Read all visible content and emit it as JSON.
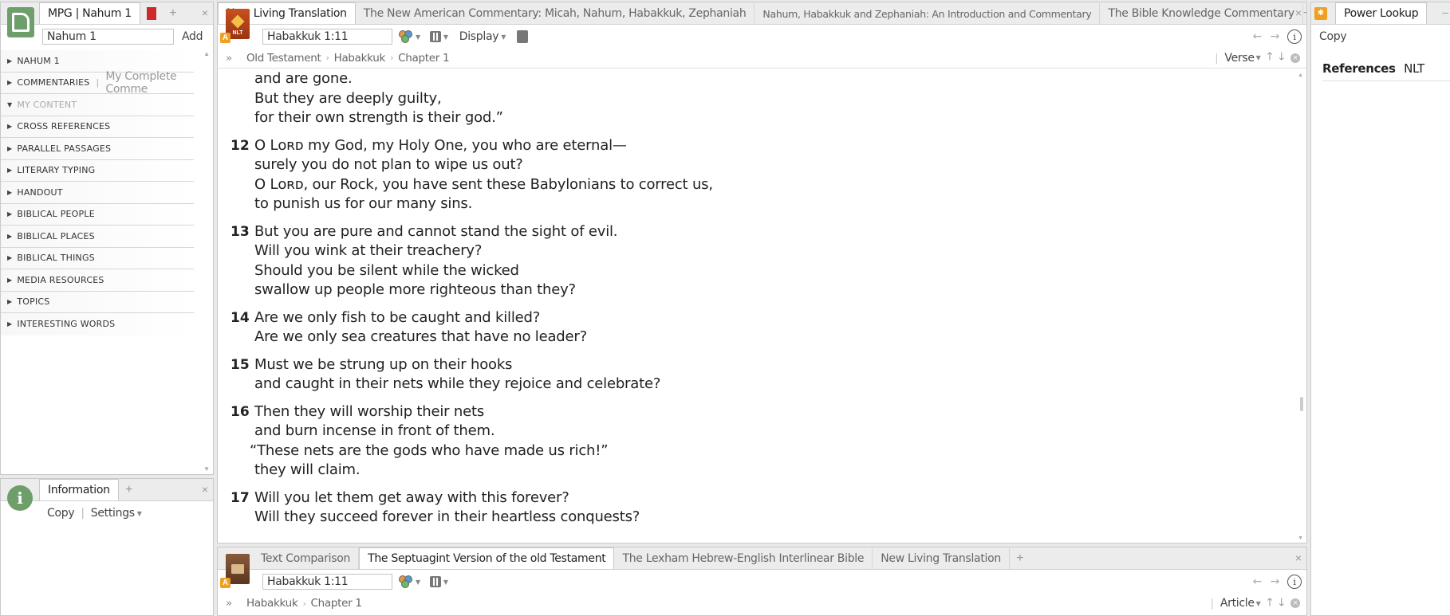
{
  "guide": {
    "tab_label": "MPG | Nahum 1",
    "reference_value": "Nahum 1",
    "add_label": "Add",
    "sections": [
      {
        "label": "NAHUM 1",
        "sub": ""
      },
      {
        "label": "COMMENTARIES",
        "sub": "My Complete Comme"
      },
      {
        "label": "MY CONTENT",
        "sub": ""
      },
      {
        "label": "CROSS REFERENCES",
        "sub": ""
      },
      {
        "label": "PARALLEL PASSAGES",
        "sub": ""
      },
      {
        "label": "LITERARY TYPING",
        "sub": ""
      },
      {
        "label": "HANDOUT",
        "sub": ""
      },
      {
        "label": "BIBLICAL PEOPLE",
        "sub": ""
      },
      {
        "label": "BIBLICAL PLACES",
        "sub": ""
      },
      {
        "label": "BIBLICAL THINGS",
        "sub": ""
      },
      {
        "label": "MEDIA RESOURCES",
        "sub": ""
      },
      {
        "label": "TOPICS",
        "sub": ""
      },
      {
        "label": "INTERESTING WORDS",
        "sub": ""
      }
    ]
  },
  "info": {
    "tab_label": "Information",
    "copy_label": "Copy",
    "settings_label": "Settings"
  },
  "main": {
    "tabs": [
      "New Living Translation",
      "The New American Commentary: Micah, Nahum, Habakkuk, Zephaniah",
      "Nahum, Habakkuk and Zephaniah: An Introduction and Commentary",
      "The Bible Knowledge Commentary"
    ],
    "icon_badge": "NLT",
    "reference": "Habakkuk 1:11",
    "display_label": "Display",
    "breadcrumb": [
      "Old Testament",
      "Habakkuk",
      "Chapter 1"
    ],
    "verse_label": "Verse",
    "top_lines": [
      "and are gone.",
      "But they are deeply guilty,",
      "for their own strength is their god.”"
    ],
    "verses": [
      {
        "num": "12",
        "lines": [
          "O Lᴏʀᴅ my God, my Holy One, you who are eternal—",
          "surely you do not plan to wipe us out?",
          "O Lᴏʀᴅ, our Rock, you have sent these Babylonians to correct us,",
          "to punish us for our many sins."
        ]
      },
      {
        "num": "13",
        "lines": [
          "But you are pure and cannot stand the sight of evil.",
          "Will you wink at their treachery?",
          "Should you be silent while the wicked",
          "swallow up people more righteous than they?"
        ]
      },
      {
        "num": "14",
        "lines": [
          "Are we only fish to be caught and killed?",
          "Are we only sea creatures that have no leader?"
        ]
      },
      {
        "num": "15",
        "lines": [
          "Must we be strung up on their hooks",
          "and caught in their nets while they rejoice and celebrate?"
        ]
      },
      {
        "num": "16",
        "lines": [
          "Then they will worship their nets",
          "and burn incense in front of them.",
          "“These nets are the gods who have made us rich!”",
          "they will claim."
        ]
      },
      {
        "num": "17",
        "lines": [
          "Will you let them get away with this forever?",
          "Will they succeed forever in their heartless conquests?"
        ]
      }
    ]
  },
  "bottom": {
    "tabs": [
      "Text Comparison",
      "The Septuagint Version of the old Testament",
      "The Lexham Hebrew-English Interlinear Bible",
      "New Living Translation"
    ],
    "reference": "Habakkuk 1:11",
    "breadcrumb": [
      "Habakkuk",
      "Chapter 1"
    ],
    "article_label": "Article"
  },
  "power": {
    "tab_label": "Power Lookup",
    "copy_label": "Copy",
    "references_label": "References",
    "references_value": "NLT"
  }
}
